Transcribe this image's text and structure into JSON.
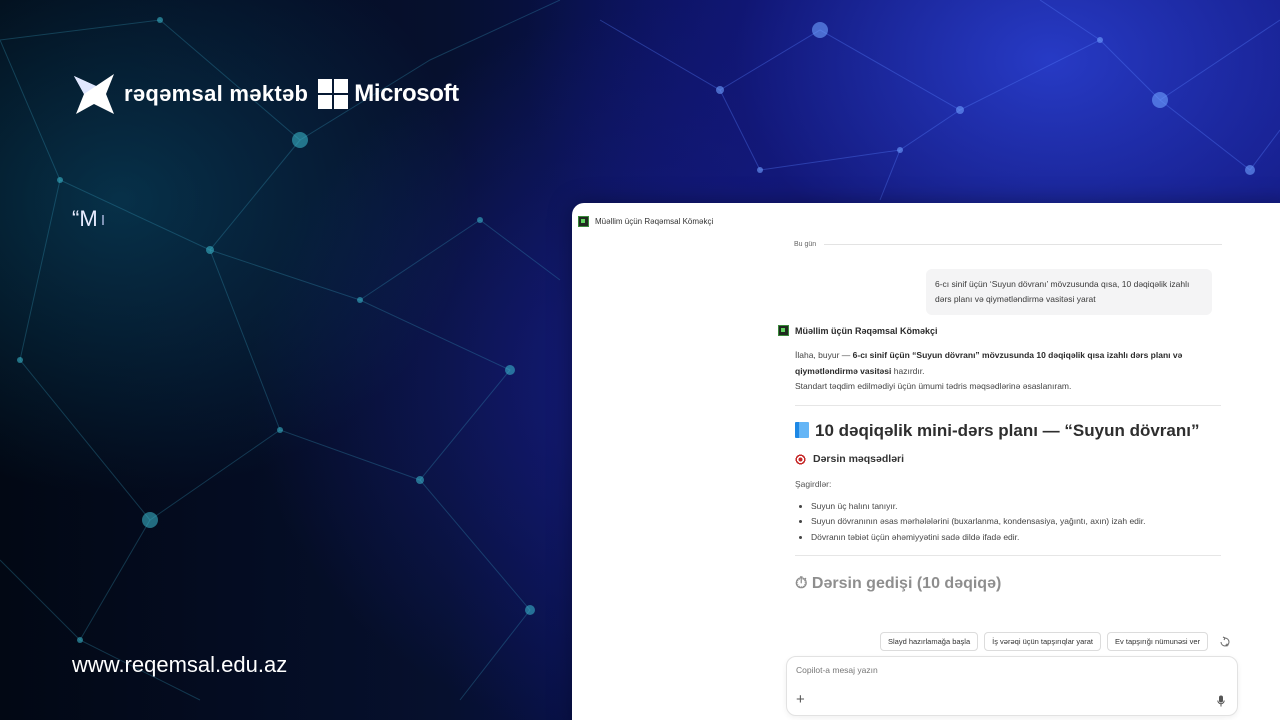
{
  "brand": {
    "name": "rəqəmsal məktəb",
    "partner": "Microsoft"
  },
  "quote_text": "“M",
  "site_url": "www.reqemsal.edu.az",
  "colors": {
    "background": "#04051a",
    "accent_blue": "#1824a6",
    "network_teal": "#2fa7b8"
  },
  "app": {
    "title": "Müəllim üçün Rəqəmsal Köməkçi",
    "day_separator": "Bu gün",
    "user_message": "6-cı sinif üçün ‘Suyun dövranı’ mövzusunda qısa, 10 dəqiqəlik izahlı dərs planı və qiymətləndirmə vasitəsi yarat",
    "bot_name": "Müəllim üçün Rəqəmsal Köməkçi",
    "bot_intro_prefix": "İlaha, buyur — ",
    "bot_intro_bold": "6-cı sinif üçün “Suyun dövranı” mövzusunda 10 dəqiqəlik qısa izahlı dərs planı və qiymətləndirmə vasitəsi",
    "bot_intro_suffix": " hazırdır.",
    "bot_note": "Standart təqdim edilmədiyi üçün ümumi tədris məqsədlərinə əsaslanıram.",
    "heading": "10 dəqiqəlik mini-dərs planı — “Suyun dövranı”",
    "objectives_heading": "Dərsin məqsədləri",
    "students_label": "Şagirdlər:",
    "goals": [
      "Suyun üç halını tanıyır.",
      "Suyun dövranının əsas mərhələlərini (buxarlanma, kondensasiya, yağıntı, axın) izah edir.",
      "Dövranın təbiət üçün əhəmiyyətini sadə dildə ifadə edir."
    ],
    "next_heading": "⏱ Dərsin gedişi (10 dəqiqə)",
    "suggestions": [
      "Slayd hazırlamağa başla",
      "İş vərəqi üçün tapşırıqlar yarat",
      "Ev tapşırığı nümunəsi ver"
    ],
    "composer_placeholder": "Copilot-a mesaj yazın",
    "icons": {
      "bot": "bot-icon",
      "heading": "book-icon",
      "objectives": "target-icon",
      "refresh": "sparkle-refresh-icon",
      "add": "plus-icon",
      "voice": "mic-icon"
    }
  }
}
